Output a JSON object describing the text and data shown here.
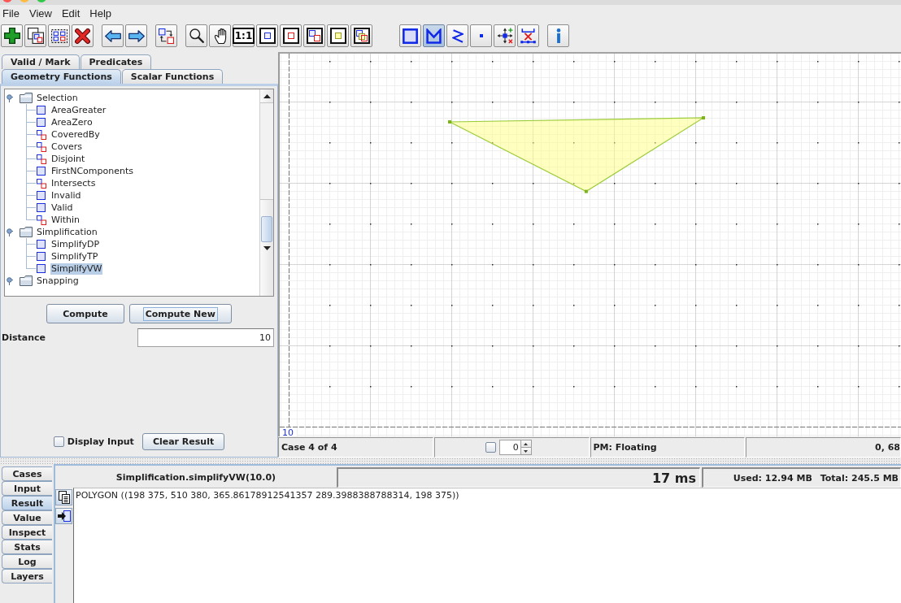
{
  "menu": [
    {
      "label": "File"
    },
    {
      "label": "View"
    },
    {
      "label": "Edit"
    },
    {
      "label": "Help"
    }
  ],
  "toolbar": [
    {
      "buttons": [
        {
          "kind": "add"
        },
        {
          "kind": "copy"
        },
        {
          "kind": "select_all"
        },
        {
          "kind": "delete"
        }
      ]
    },
    {
      "buttons": [
        {
          "kind": "previous"
        },
        {
          "kind": "next"
        }
      ]
    },
    {
      "buttons": [
        {
          "kind": "swap"
        }
      ]
    },
    {
      "buttons": [
        {
          "kind": "zoom"
        },
        {
          "kind": "pan"
        },
        {
          "kind": "actual_size",
          "label": "1:1"
        },
        {
          "kind": "zoom_a"
        },
        {
          "kind": "zoom_b"
        },
        {
          "kind": "zoom_ab"
        },
        {
          "kind": "zoom_result"
        },
        {
          "kind": "zoom_all"
        }
      ]
    },
    {
      "buttons": [
        {
          "kind": "rectangle",
          "selected": false
        },
        {
          "kind": "polygon",
          "selected": true
        },
        {
          "kind": "linestring",
          "selected": false
        },
        {
          "kind": "point",
          "selected": false
        },
        {
          "kind": "edit_vertex",
          "selected": false
        },
        {
          "kind": "delete_vertex",
          "selected": false
        }
      ]
    },
    {
      "buttons": [
        {
          "kind": "info"
        }
      ]
    }
  ],
  "function_panel": {
    "tab_rows": [
      {
        "tabs": [
          {
            "label": "Valid / Mark",
            "selected": false
          },
          {
            "label": "Predicates",
            "selected": false
          }
        ]
      },
      {
        "tabs": [
          {
            "label": "Geometry Functions",
            "selected": true
          },
          {
            "label": "Scalar Functions",
            "selected": false
          }
        ]
      }
    ],
    "tree": [
      {
        "label": "Selection",
        "expanded": true,
        "children": [
          {
            "label": "AreaGreater",
            "kind": "unary",
            "selected": false
          },
          {
            "label": "AreaZero",
            "kind": "unary",
            "selected": false
          },
          {
            "label": "CoveredBy",
            "kind": "binary",
            "selected": false
          },
          {
            "label": "Covers",
            "kind": "binary",
            "selected": false
          },
          {
            "label": "Disjoint",
            "kind": "binary",
            "selected": false
          },
          {
            "label": "FirstNComponents",
            "kind": "unary",
            "selected": false
          },
          {
            "label": "Intersects",
            "kind": "binary",
            "selected": false
          },
          {
            "label": "Invalid",
            "kind": "unary",
            "selected": false
          },
          {
            "label": "Valid",
            "kind": "unary",
            "selected": false
          },
          {
            "label": "Within",
            "kind": "binary",
            "selected": false
          }
        ]
      },
      {
        "label": "Simplification",
        "expanded": true,
        "children": [
          {
            "label": "SimplifyDP",
            "kind": "unary",
            "selected": false
          },
          {
            "label": "SimplifyTP",
            "kind": "unary",
            "selected": false
          },
          {
            "label": "SimplifyVW",
            "kind": "unary",
            "selected": true
          }
        ]
      },
      {
        "label": "Snapping",
        "expanded": true
      }
    ],
    "buttons": [
      {
        "label": "Compute",
        "focused": false
      },
      {
        "label": "Compute New",
        "focused": true
      }
    ],
    "parameters": [
      {
        "label": "Distance",
        "value": "10"
      }
    ],
    "display_input": {
      "label": "Display Input",
      "checked": false
    },
    "clear_button": {
      "label": "Clear Result"
    }
  },
  "canvas": {
    "scale_label": "10"
  },
  "status_bar": {
    "case_label": "Case 4 of 4",
    "checkbox": {
      "checked": false
    },
    "spinner": {
      "value": "0"
    },
    "precision": "PM: Floating",
    "coordinates": "0, 68"
  },
  "result_panel": {
    "tabs": [
      {
        "label": "Cases",
        "selected": false
      },
      {
        "label": "Input",
        "selected": false
      },
      {
        "label": "Result",
        "selected": true
      },
      {
        "label": "Value",
        "selected": false
      },
      {
        "label": "Inspect",
        "selected": false
      },
      {
        "label": "Stats",
        "selected": false
      },
      {
        "label": "Log",
        "selected": false
      },
      {
        "label": "Layers",
        "selected": false
      }
    ],
    "operation": "Simplification.simplifyVW(10.0)",
    "elapsed": "17 ms",
    "memory_used": "Used: 12.94 MB",
    "memory_total": "Total: 245.5 MB",
    "result_text": "POLYGON ((198 375, 510 380, 365.86178912541357 289.3988388788314, 198 375))"
  }
}
